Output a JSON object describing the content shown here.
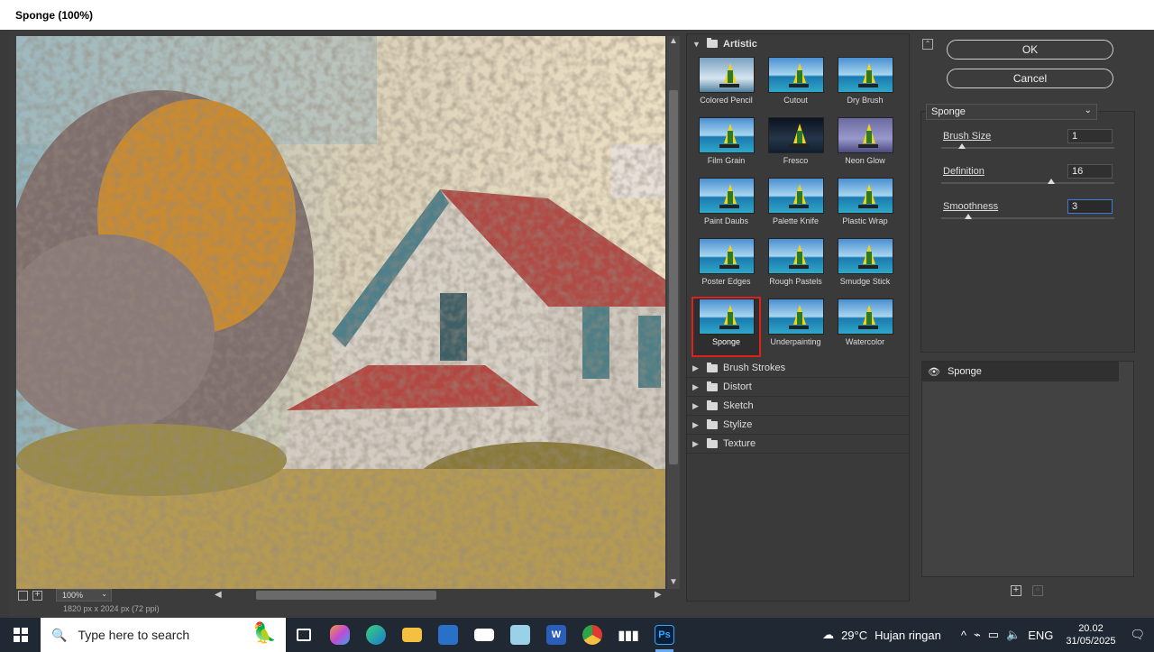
{
  "window": {
    "title": "Sponge (100%)"
  },
  "preview": {
    "zoom": "100%",
    "doc_info": "1820 px x 2024 px (72 ppi)"
  },
  "gallery": {
    "open_category": "Artistic",
    "filters": [
      {
        "label": "Colored Pencil",
        "style": "gray"
      },
      {
        "label": "Cutout",
        "style": ""
      },
      {
        "label": "Dry Brush",
        "style": ""
      },
      {
        "label": "Film Grain",
        "style": ""
      },
      {
        "label": "Fresco",
        "style": "dark"
      },
      {
        "label": "Neon Glow",
        "style": "neon"
      },
      {
        "label": "Paint Daubs",
        "style": ""
      },
      {
        "label": "Palette Knife",
        "style": ""
      },
      {
        "label": "Plastic Wrap",
        "style": ""
      },
      {
        "label": "Poster Edges",
        "style": ""
      },
      {
        "label": "Rough Pastels",
        "style": ""
      },
      {
        "label": "Smudge Stick",
        "style": ""
      },
      {
        "label": "Sponge",
        "style": "",
        "selected": true
      },
      {
        "label": "Underpainting",
        "style": ""
      },
      {
        "label": "Watercolor",
        "style": ""
      }
    ],
    "categories": [
      "Brush Strokes",
      "Distort",
      "Sketch",
      "Stylize",
      "Texture"
    ]
  },
  "buttons": {
    "ok": "OK",
    "cancel": "Cancel"
  },
  "settings": {
    "filter_name": "Sponge",
    "params": [
      {
        "label": "Brush Size",
        "value": "1",
        "fraction": 0.11
      },
      {
        "label": "Definition",
        "value": "16",
        "fraction": 0.64
      },
      {
        "label": "Smoothness",
        "value": "3",
        "fraction": 0.15
      }
    ]
  },
  "layers": {
    "items": [
      "Sponge"
    ]
  },
  "taskbar": {
    "search_placeholder": "Type here to search",
    "weather_temp": "29°C",
    "weather_desc": "Hujan ringan",
    "language": "ENG",
    "time": "20.02",
    "date": "31/05/2025",
    "apps": [
      "task-view",
      "copilot",
      "edge",
      "file-explorer",
      "microsoft-store",
      "mail",
      "notepad",
      "word",
      "chrome",
      "audio-app",
      "photoshop"
    ]
  }
}
